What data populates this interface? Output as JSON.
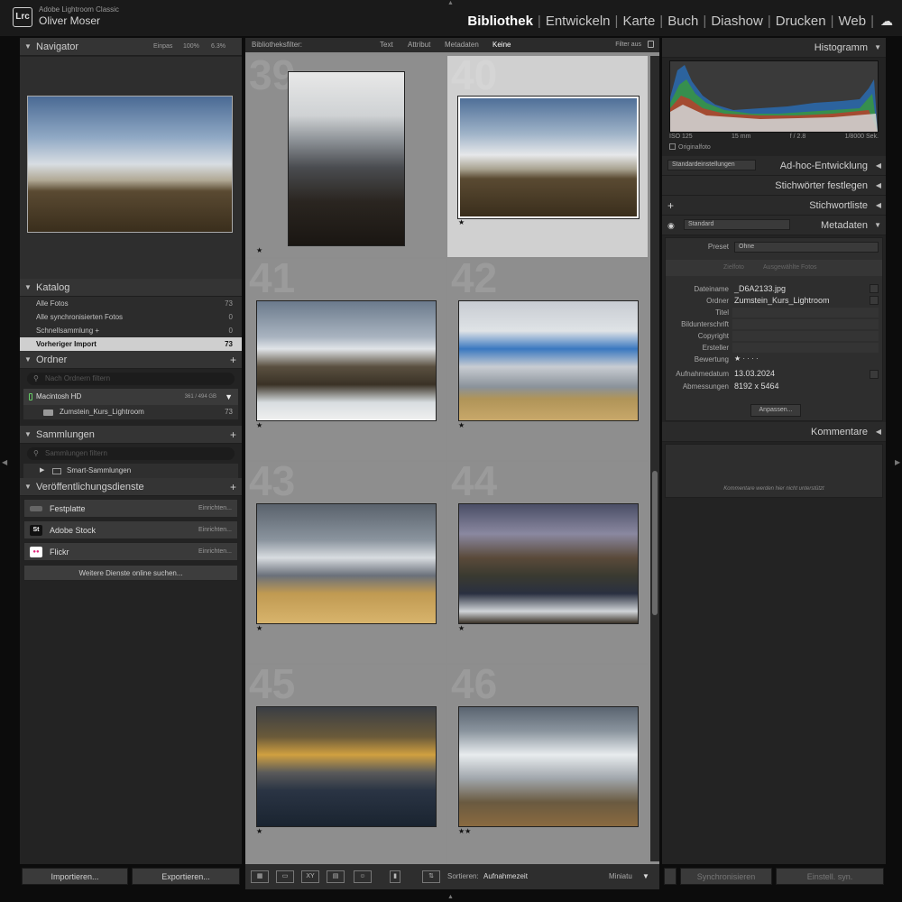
{
  "header": {
    "app_name": "Adobe Lightroom Classic",
    "user": "Oliver Moser",
    "logo": "Lrc",
    "modules": [
      "Bibliothek",
      "Entwickeln",
      "Karte",
      "Buch",
      "Diashow",
      "Drucken",
      "Web"
    ],
    "active_module": "Bibliothek",
    "cloud_icon": "cloud-icon"
  },
  "navigator": {
    "title": "Navigator",
    "zoom_fit": "Einpas",
    "zoom_100": "100%",
    "zoom_pct": "6.3%"
  },
  "catalog": {
    "title": "Katalog",
    "items": [
      {
        "label": "Alle Fotos",
        "count": "73"
      },
      {
        "label": "Alle synchronisierten Fotos",
        "count": "0"
      },
      {
        "label": "Schnellsammlung +",
        "count": "0"
      },
      {
        "label": "Vorheriger Import",
        "count": "73"
      }
    ]
  },
  "folders": {
    "title": "Ordner",
    "search_placeholder": "Nach Ordnern filtern",
    "volume": "Macintosh HD",
    "volume_capacity": "361 / 494 GB",
    "folder": "Zumstein_Kurs_Lightroom",
    "folder_count": "73"
  },
  "collections": {
    "title": "Sammlungen",
    "search_placeholder": "Sammlungen filtern",
    "smart": "Smart-Sammlungen"
  },
  "publish": {
    "title": "Veröffentlichungsdienste",
    "services": [
      {
        "label": "Festplatte",
        "action": "Einrichten...",
        "icon": "harddisk-icon",
        "badge": ""
      },
      {
        "label": "Adobe Stock",
        "action": "Einrichten...",
        "icon": "adobe-stock-icon",
        "badge": "St"
      },
      {
        "label": "Flickr",
        "action": "Einrichten...",
        "icon": "flickr-icon",
        "badge": "●●"
      }
    ],
    "more": "Weitere Dienste online suchen..."
  },
  "left_buttons": {
    "import": "Importieren...",
    "export": "Exportieren..."
  },
  "filter_bar": {
    "label": "Bibliotheksfilter:",
    "options": [
      "Text",
      "Attribut",
      "Metadaten",
      "Keine"
    ],
    "active": "Keine",
    "filter_off": "Filter aus"
  },
  "grid": {
    "cells": [
      {
        "num": "39",
        "stars": "★"
      },
      {
        "num": "40",
        "stars": "★"
      },
      {
        "num": "41",
        "stars": "★"
      },
      {
        "num": "42",
        "stars": "★"
      },
      {
        "num": "43",
        "stars": "★"
      },
      {
        "num": "44",
        "stars": "★"
      },
      {
        "num": "45",
        "stars": "★"
      },
      {
        "num": "46",
        "stars": "★★"
      }
    ],
    "selected_num": "40"
  },
  "toolbar": {
    "sort_label": "Sortieren:",
    "sort_value": "Aufnahmezeit",
    "thumb_label": "Miniatu"
  },
  "histogram": {
    "title": "Histogramm",
    "iso": "ISO 125",
    "focal": "15 mm",
    "aperture": "f / 2.8",
    "shutter": "1/8000 Sek.",
    "original": "Originalfoto"
  },
  "quick_develop": {
    "title": "Ad-hoc-Entwicklung",
    "preset": "Standardeinstellungen"
  },
  "keywording": {
    "title": "Stichwörter festlegen"
  },
  "keyword_list": {
    "title": "Stichwortliste"
  },
  "metadata": {
    "title": "Metadaten",
    "preset_dd": "Standard",
    "preset_label": "Preset",
    "preset_value": "Ohne",
    "target_photo": "Zielfoto",
    "selected_photos": "Ausgewählte Fotos",
    "fields": [
      {
        "label": "Dateiname",
        "value": "_D6A2133.jpg"
      },
      {
        "label": "Ordner",
        "value": "Zumstein_Kurs_Lightroom"
      },
      {
        "label": "Titel",
        "value": ""
      },
      {
        "label": "Bildunterschrift",
        "value": ""
      },
      {
        "label": "Copyright",
        "value": ""
      },
      {
        "label": "Ersteller",
        "value": ""
      },
      {
        "label": "Bewertung",
        "value": "★ · · · ·"
      },
      {
        "label": "Aufnahmedatum",
        "value": "13.03.2024"
      },
      {
        "label": "Abmessungen",
        "value": "8192 x 5464"
      }
    ],
    "customize": "Anpassen..."
  },
  "comments": {
    "title": "Kommentare",
    "note": "Kommentare werden hier nicht unterstützt"
  },
  "right_buttons": {
    "sync": "Synchronisieren",
    "sync_settings": "Einstell. syn."
  }
}
